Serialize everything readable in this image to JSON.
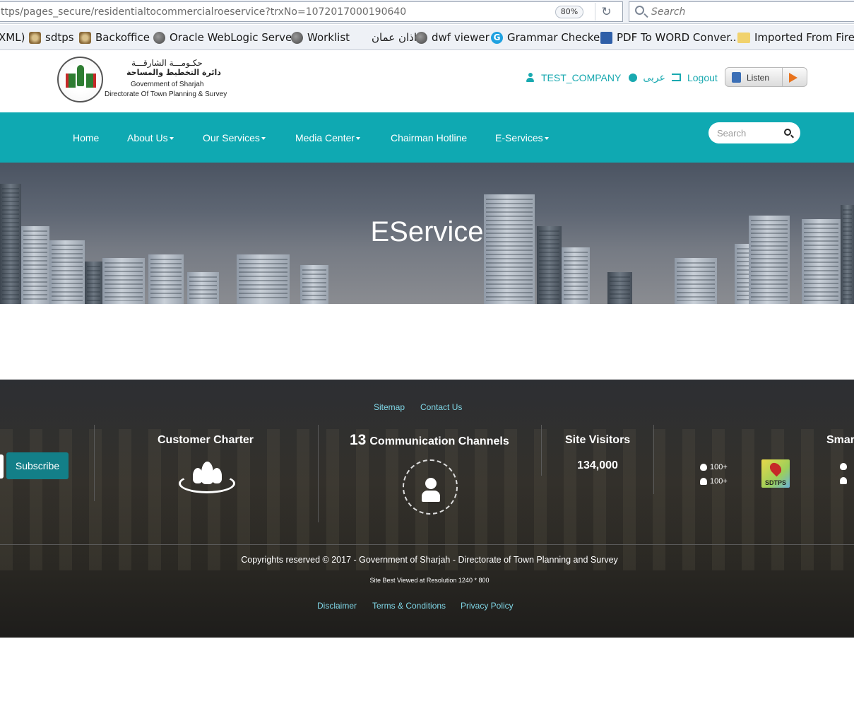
{
  "browser": {
    "url": "ttps/pages_secure/residentialtocommercialroeservice?trxNo=1072017000190640",
    "zoom": "80%",
    "search_placeholder": "Search",
    "bookmarks": [
      {
        "label": "XML)",
        "icon": "none"
      },
      {
        "label": "sdtps",
        "icon": "crest-icon"
      },
      {
        "label": "Backoffice",
        "icon": "crest-icon"
      },
      {
        "label": "Oracle WebLogic Server",
        "icon": "globe-icon"
      },
      {
        "label": "Worklist",
        "icon": "globe-icon"
      },
      {
        "label": "اذان عمان",
        "icon": "none"
      },
      {
        "label": "dwf viewer",
        "icon": "globe-icon"
      },
      {
        "label": "Grammar Checker",
        "icon": "grammarly-icon"
      },
      {
        "label": "PDF To WORD Conver...",
        "icon": "pdf-icon"
      },
      {
        "label": "Imported From Firefox",
        "icon": "folder-icon"
      }
    ]
  },
  "header": {
    "logo_ar_line1": "حكـومـــة الشارقـــة",
    "logo_ar_line2": "دائرة التخطيط والمساحة",
    "logo_en_line1": "Government of Sharjah",
    "logo_en_line2": "Directorate Of Town Planning & Survey",
    "username": "TEST_COMPANY",
    "language": "عربى",
    "logout": "Logout",
    "listen": "Listen"
  },
  "nav": {
    "items": [
      "Home",
      "About Us",
      "Our Services",
      "Media Center",
      "Chairman Hotline",
      "E-Services"
    ],
    "search_placeholder": "Search"
  },
  "hero": {
    "title": "EService"
  },
  "footer": {
    "top_links": [
      "Sitemap",
      "Contact Us"
    ],
    "subscribe": "Subscribe",
    "customer_charter": "Customer Charter",
    "channels_count": "13",
    "channels_label": "Communication Channels",
    "site_visitors_label": "Site Visitors",
    "site_visitors_value": "134,000",
    "app_counts": [
      "100+",
      "100+"
    ],
    "sdtps_label": "SDTPS",
    "smart_label": "Smar",
    "copyright": "Copyrights reserved © 2017 - Government of Sharjah - Directorate of Town Planning and Survey",
    "resolution": "Site Best Viewed at Resolution 1240 * 800",
    "bottom_links": [
      "Disclaimer",
      "Terms & Conditions",
      "Privacy Policy"
    ]
  },
  "colors": {
    "brand_teal": "#0fa9b2",
    "link_teal": "#19a9b0",
    "subscribe_bg": "#137f88"
  }
}
